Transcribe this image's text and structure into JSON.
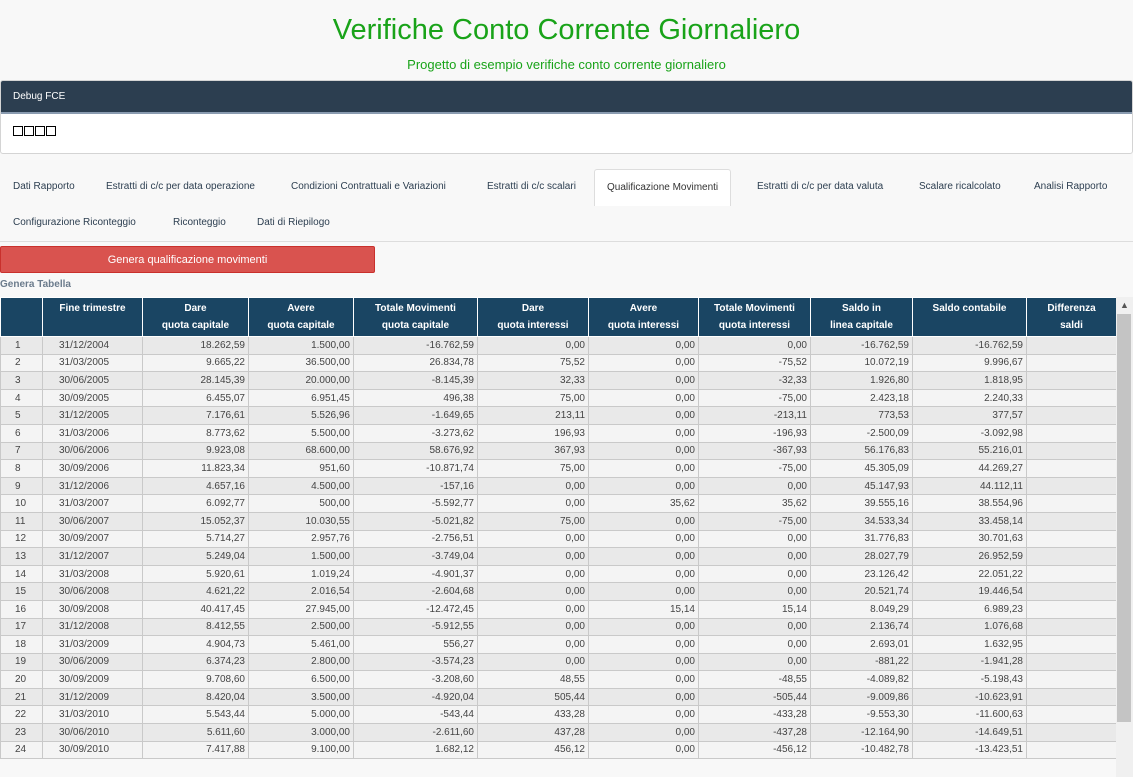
{
  "header": {
    "title": "Verifiche Conto Corrente Giornaliero",
    "subtitle": "Progetto di esempio verifiche conto corrente giornaliero"
  },
  "debug": {
    "title": "Debug FCE"
  },
  "tabs": [
    {
      "label": "Dati Rapporto"
    },
    {
      "label": "Estratti di c/c per data operazione"
    },
    {
      "label": "Condizioni Contrattuali e Variazioni"
    },
    {
      "label": "Estratti di c/c scalari"
    },
    {
      "label": "Qualificazione Movimenti"
    },
    {
      "label": "Estratti di c/c per data valuta"
    },
    {
      "label": "Scalare ricalcolato"
    },
    {
      "label": "Analisi Rapporto"
    },
    {
      "label": "Configurazione Riconteggio"
    },
    {
      "label": "Riconteggio"
    },
    {
      "label": "Dati di Riepilogo"
    }
  ],
  "generate_button": "Genera qualificazione movimenti",
  "section_label": "Genera Tabella",
  "table": {
    "columns": [
      {
        "line1": "",
        "line2": ""
      },
      {
        "line1": "Fine trimestre",
        "line2": ""
      },
      {
        "line1": "Dare",
        "line2": "quota capitale"
      },
      {
        "line1": "Avere",
        "line2": "quota capitale"
      },
      {
        "line1": "Totale Movimenti",
        "line2": "quota capitale"
      },
      {
        "line1": "Dare",
        "line2": "quota interessi"
      },
      {
        "line1": "Avere",
        "line2": "quota interessi"
      },
      {
        "line1": "Totale Movimenti",
        "line2": "quota interessi"
      },
      {
        "line1": "Saldo in",
        "line2": "linea capitale"
      },
      {
        "line1": "Saldo contabile",
        "line2": ""
      },
      {
        "line1": "Differenza",
        "line2": "saldi"
      }
    ],
    "rows": [
      [
        "1",
        "31/12/2004",
        "18.262,59",
        "1.500,00",
        "-16.762,59",
        "0,00",
        "0,00",
        "0,00",
        "-16.762,59",
        "-16.762,59",
        ""
      ],
      [
        "2",
        "31/03/2005",
        "9.665,22",
        "36.500,00",
        "26.834,78",
        "75,52",
        "0,00",
        "-75,52",
        "10.072,19",
        "9.996,67",
        ""
      ],
      [
        "3",
        "30/06/2005",
        "28.145,39",
        "20.000,00",
        "-8.145,39",
        "32,33",
        "0,00",
        "-32,33",
        "1.926,80",
        "1.818,95",
        ""
      ],
      [
        "4",
        "30/09/2005",
        "6.455,07",
        "6.951,45",
        "496,38",
        "75,00",
        "0,00",
        "-75,00",
        "2.423,18",
        "2.240,33",
        ""
      ],
      [
        "5",
        "31/12/2005",
        "7.176,61",
        "5.526,96",
        "-1.649,65",
        "213,11",
        "0,00",
        "-213,11",
        "773,53",
        "377,57",
        ""
      ],
      [
        "6",
        "31/03/2006",
        "8.773,62",
        "5.500,00",
        "-3.273,62",
        "196,93",
        "0,00",
        "-196,93",
        "-2.500,09",
        "-3.092,98",
        ""
      ],
      [
        "7",
        "30/06/2006",
        "9.923,08",
        "68.600,00",
        "58.676,92",
        "367,93",
        "0,00",
        "-367,93",
        "56.176,83",
        "55.216,01",
        ""
      ],
      [
        "8",
        "30/09/2006",
        "11.823,34",
        "951,60",
        "-10.871,74",
        "75,00",
        "0,00",
        "-75,00",
        "45.305,09",
        "44.269,27",
        ""
      ],
      [
        "9",
        "31/12/2006",
        "4.657,16",
        "4.500,00",
        "-157,16",
        "0,00",
        "0,00",
        "0,00",
        "45.147,93",
        "44.112,11",
        ""
      ],
      [
        "10",
        "31/03/2007",
        "6.092,77",
        "500,00",
        "-5.592,77",
        "0,00",
        "35,62",
        "35,62",
        "39.555,16",
        "38.554,96",
        ""
      ],
      [
        "11",
        "30/06/2007",
        "15.052,37",
        "10.030,55",
        "-5.021,82",
        "75,00",
        "0,00",
        "-75,00",
        "34.533,34",
        "33.458,14",
        ""
      ],
      [
        "12",
        "30/09/2007",
        "5.714,27",
        "2.957,76",
        "-2.756,51",
        "0,00",
        "0,00",
        "0,00",
        "31.776,83",
        "30.701,63",
        ""
      ],
      [
        "13",
        "31/12/2007",
        "5.249,04",
        "1.500,00",
        "-3.749,04",
        "0,00",
        "0,00",
        "0,00",
        "28.027,79",
        "26.952,59",
        ""
      ],
      [
        "14",
        "31/03/2008",
        "5.920,61",
        "1.019,24",
        "-4.901,37",
        "0,00",
        "0,00",
        "0,00",
        "23.126,42",
        "22.051,22",
        ""
      ],
      [
        "15",
        "30/06/2008",
        "4.621,22",
        "2.016,54",
        "-2.604,68",
        "0,00",
        "0,00",
        "0,00",
        "20.521,74",
        "19.446,54",
        ""
      ],
      [
        "16",
        "30/09/2008",
        "40.417,45",
        "27.945,00",
        "-12.472,45",
        "0,00",
        "15,14",
        "15,14",
        "8.049,29",
        "6.989,23",
        ""
      ],
      [
        "17",
        "31/12/2008",
        "8.412,55",
        "2.500,00",
        "-5.912,55",
        "0,00",
        "0,00",
        "0,00",
        "2.136,74",
        "1.076,68",
        ""
      ],
      [
        "18",
        "31/03/2009",
        "4.904,73",
        "5.461,00",
        "556,27",
        "0,00",
        "0,00",
        "0,00",
        "2.693,01",
        "1.632,95",
        ""
      ],
      [
        "19",
        "30/06/2009",
        "6.374,23",
        "2.800,00",
        "-3.574,23",
        "0,00",
        "0,00",
        "0,00",
        "-881,22",
        "-1.941,28",
        ""
      ],
      [
        "20",
        "30/09/2009",
        "9.708,60",
        "6.500,00",
        "-3.208,60",
        "48,55",
        "0,00",
        "-48,55",
        "-4.089,82",
        "-5.198,43",
        ""
      ],
      [
        "21",
        "31/12/2009",
        "8.420,04",
        "3.500,00",
        "-4.920,04",
        "505,44",
        "0,00",
        "-505,44",
        "-9.009,86",
        "-10.623,91",
        ""
      ],
      [
        "22",
        "31/03/2010",
        "5.543,44",
        "5.000,00",
        "-543,44",
        "433,28",
        "0,00",
        "-433,28",
        "-9.553,30",
        "-11.600,63",
        ""
      ],
      [
        "23",
        "30/06/2010",
        "5.611,60",
        "3.000,00",
        "-2.611,60",
        "437,28",
        "0,00",
        "-437,28",
        "-12.164,90",
        "-14.649,51",
        ""
      ],
      [
        "24",
        "30/09/2010",
        "7.417,88",
        "9.100,00",
        "1.682,12",
        "456,12",
        "0,00",
        "-456,12",
        "-10.482,78",
        "-13.423,51",
        ""
      ]
    ]
  },
  "colors": {
    "title_green": "#19a319",
    "header_navy": "#2c3e50",
    "table_header": "#1a4563",
    "button_red": "#d9534f"
  },
  "icons": {
    "scroll_up": "scroll-up-arrow-icon"
  }
}
